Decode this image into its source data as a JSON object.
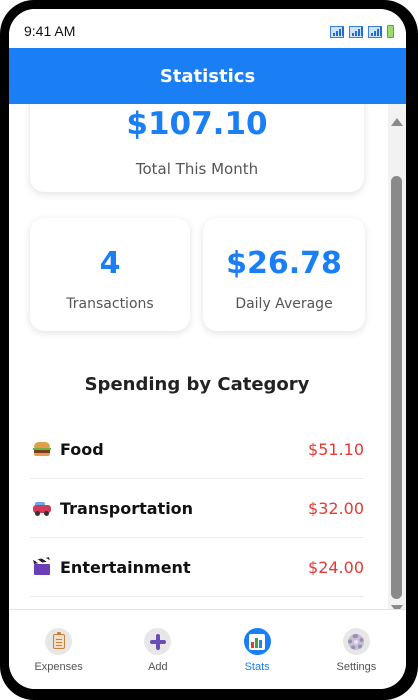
{
  "status_bar": {
    "time": "9:41 AM"
  },
  "header": {
    "title": "Statistics"
  },
  "summary": {
    "total_amount": "$107.10",
    "total_label": "Total This Month",
    "transactions_value": "4",
    "transactions_label": "Transactions",
    "daily_average_value": "$26.78",
    "daily_average_label": "Daily Average"
  },
  "categories": {
    "title": "Spending by Category",
    "items": [
      {
        "icon": "burger-icon",
        "name": "Food",
        "amount": "$51.10"
      },
      {
        "icon": "car-icon",
        "name": "Transportation",
        "amount": "$32.00"
      },
      {
        "icon": "clapperboard-icon",
        "name": "Entertainment",
        "amount": "$24.00"
      }
    ]
  },
  "nav": {
    "items": [
      {
        "icon": "clipboard-icon",
        "label": "Expenses",
        "active": false
      },
      {
        "icon": "plus-icon",
        "label": "Add",
        "active": false
      },
      {
        "icon": "bar-chart-icon",
        "label": "Stats",
        "active": true
      },
      {
        "icon": "gear-icon",
        "label": "Settings",
        "active": false
      }
    ]
  },
  "colors": {
    "accent": "#1a7ef5",
    "amount_negative": "#e53935"
  }
}
